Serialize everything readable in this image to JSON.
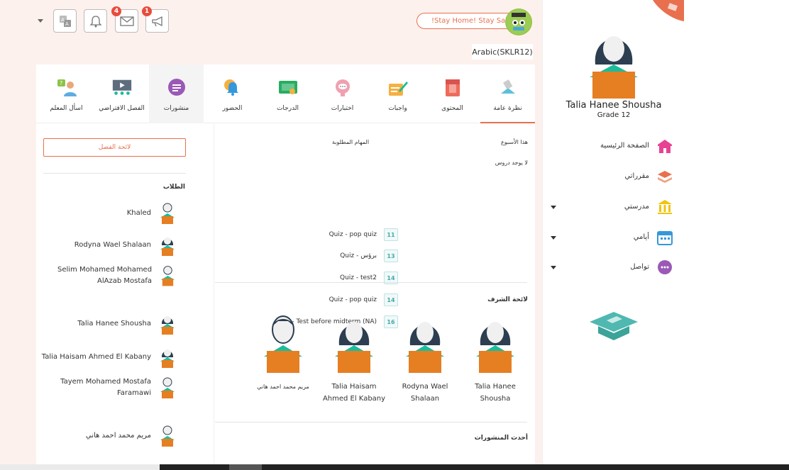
{
  "topbar": {
    "badges": {
      "messages": "4",
      "announcements": "1"
    },
    "stay_home": "!Stay Home! Stay Safe",
    "language": "Arabic(SKLR12)"
  },
  "tabs": [
    {
      "label": "نظرة عامة",
      "icon": "overview-icon"
    },
    {
      "label": "المحتوى",
      "icon": "book-icon"
    },
    {
      "label": "واجبات",
      "icon": "assignment-icon"
    },
    {
      "label": "اختبارات",
      "icon": "quiz-icon"
    },
    {
      "label": "الدرجات",
      "icon": "grades-icon"
    },
    {
      "label": "الحضور",
      "icon": "attendance-icon"
    },
    {
      "label": "منشورات",
      "icon": "posts-icon"
    },
    {
      "label": "الفصل الافتراضي",
      "icon": "virtual-class-icon"
    },
    {
      "label": "اسأل المعلم",
      "icon": "ask-teacher-icon"
    }
  ],
  "left": {
    "class_button": "لائحة الفصل",
    "students_title": "الطلاب",
    "students": [
      "Khaled",
      "Rodyna Wael Shalaan",
      "Selim Mohamed Mohamed AlAzab Mostafa",
      "Talia Hanee Shousha",
      "Talia Haisam Ahmed El Kabany",
      "Tayem Mohamed Mostafa Faramawi",
      "مريم محمد احمد هاني"
    ]
  },
  "middle": {
    "this_week": "هذا الأسبوع",
    "no_lessons": "لا يوجد دروس",
    "tasks_title": "المهام المطلوبة",
    "tasks": [
      {
        "name": "Quiz - pop quiz",
        "day": "11"
      },
      {
        "name": "Quiz - برؤس",
        "day": "13"
      },
      {
        "name": "Quiz - test2",
        "day": "14"
      },
      {
        "name": "Quiz - pop quiz",
        "day": "14"
      },
      {
        "name": "Quiz - Test before midterm (NA)",
        "day": "16"
      }
    ],
    "honor_title": "لائحة الشرف",
    "honor": [
      "Talia Hanee Shousha",
      "Rodyna Wael Shalaan",
      "Talia Haisam Ahmed El Kabany",
      "مريم محمد احمد هاني"
    ],
    "latest_posts": "أحدث المنشورات"
  },
  "profile": {
    "name": "Talia Hanee Shousha",
    "grade": "Grade 12"
  },
  "nav": [
    {
      "label": "الصفحة الرئيسية",
      "icon": "home-icon",
      "caret": false
    },
    {
      "label": "مقرراتي",
      "icon": "courses-icon",
      "caret": false
    },
    {
      "label": "مدرستي",
      "icon": "school-icon",
      "caret": true
    },
    {
      "label": "أيامي",
      "icon": "calendar-icon",
      "caret": true
    },
    {
      "label": "تواصل",
      "icon": "chat-icon",
      "caret": true
    }
  ],
  "colors": {
    "accent": "#e8704e",
    "teal": "#1abc9c",
    "background": "#fdf1ee"
  }
}
